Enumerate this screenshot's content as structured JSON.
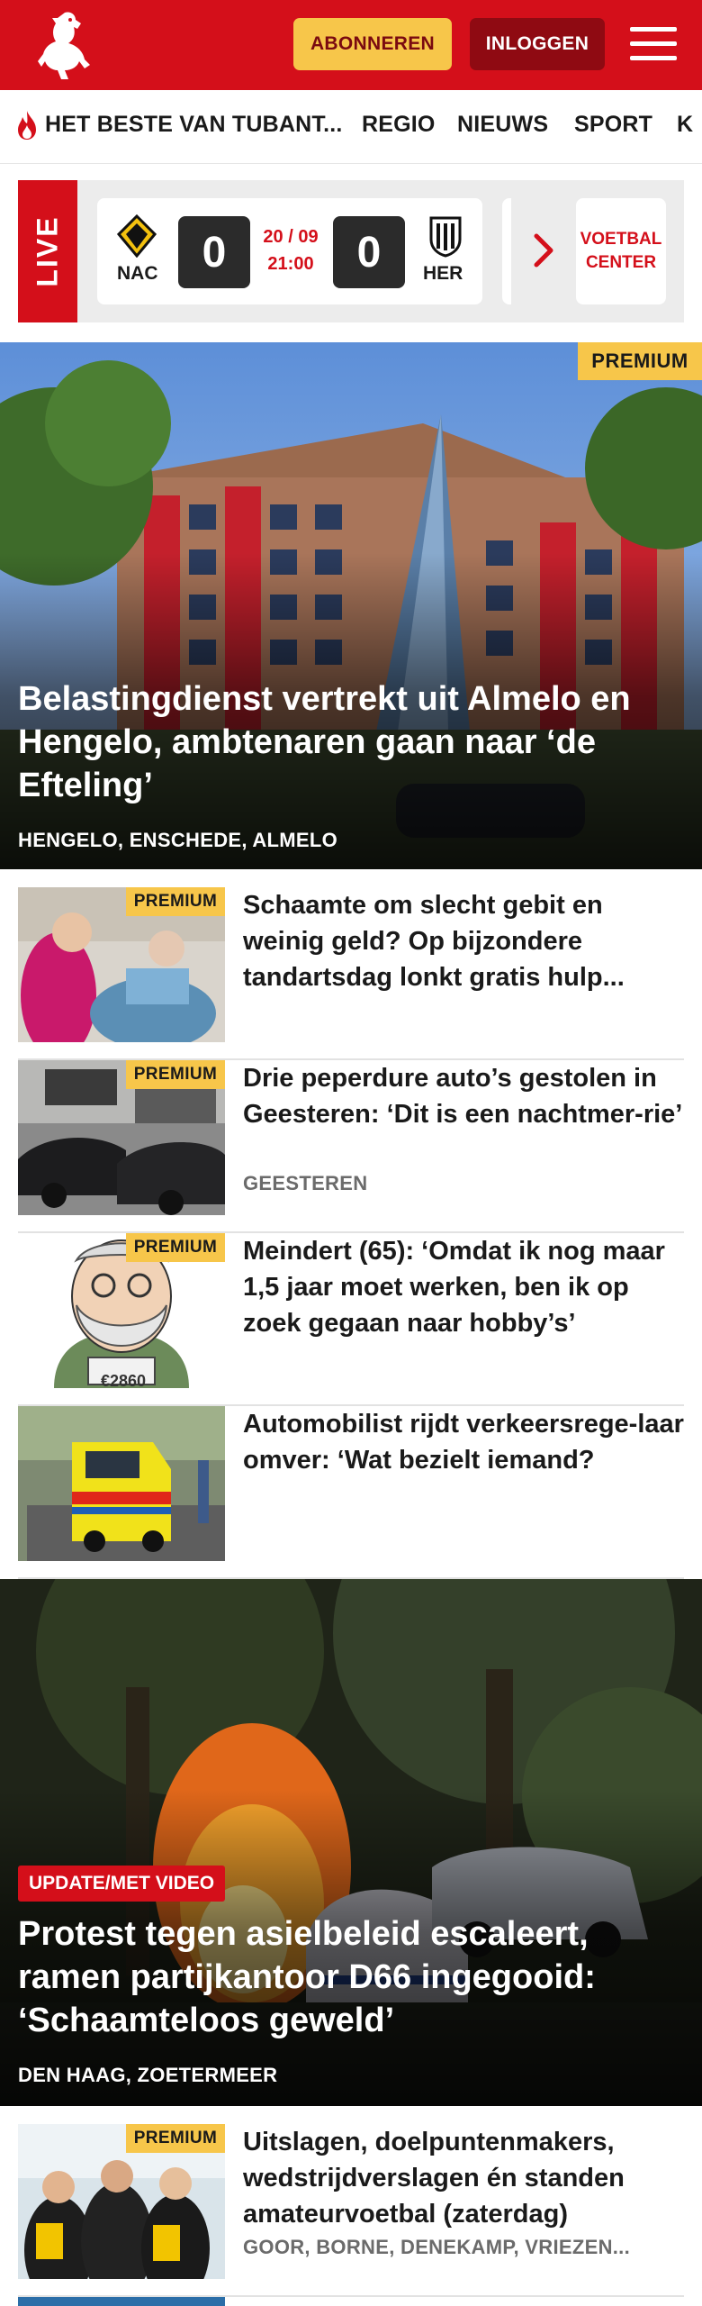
{
  "header": {
    "subscribe_label": "ABONNEREN",
    "login_label": "INLOGGEN",
    "brand_color": "#d40f1a",
    "accent_color": "#f7c64a"
  },
  "nav": {
    "items": [
      "HET BESTE VAN TUBANT...",
      "REGIO",
      "NIEUWS",
      "SPORT",
      "K"
    ]
  },
  "live": {
    "label": "LIVE",
    "match": {
      "home": "NAC",
      "away": "HER",
      "home_score": "0",
      "away_score": "0",
      "date": "20 / 09",
      "time": "21:00"
    },
    "voetbal_center_line1": "VOETBAL",
    "voetbal_center_line2": "CENTER"
  },
  "hero1": {
    "premium": "PREMIUM",
    "title": "Belastingdienst vertrekt uit Almelo en Hengelo, ambtenaren gaan naar ‘de Efteling’",
    "location": "HENGELO, ENSCHEDE, ALMELO"
  },
  "articles": [
    {
      "premium": "PREMIUM",
      "title": "Schaamte om slecht gebit en weinig geld? Op bijzondere tandartsdag lonkt gratis hulp...",
      "location": ""
    },
    {
      "premium": "PREMIUM",
      "title": "Drie peperdure auto’s gestolen in Geesteren: ‘Dit is een nachtmer-rie’",
      "location": "GEESTEREN"
    },
    {
      "premium": "PREMIUM",
      "title": "Meindert (65): ‘Omdat ik nog maar 1,5 jaar moet werken, ben ik op zoek gegaan naar hobby’s’",
      "location": "",
      "thumb_text": "€2860"
    },
    {
      "premium": "",
      "title": "Automobilist rijdt verkeersrege-laar omver: ‘Wat bezielt iemand?",
      "location": ""
    }
  ],
  "hero2": {
    "flag": "UPDATE/MET VIDEO",
    "title": "Protest tegen asielbeleid escaleert, ramen partijkantoor D66 ingegooid: ‘Schaamteloos geweld’",
    "location": "DEN HAAG, ZOETERMEER"
  },
  "article5": {
    "premium": "PREMIUM",
    "title": "Uitslagen, doelpuntenmakers, wedstrijdverslagen én standen amateurvoetbal (zaterdag)",
    "location": "GOOR, BORNE, DENEKAMP, VRIEZEN..."
  },
  "icons": {
    "logo": "tubantia-horse-logo",
    "menu": "hamburger-icon",
    "flame": "flame-icon",
    "chevron": "chevron-right-icon"
  }
}
